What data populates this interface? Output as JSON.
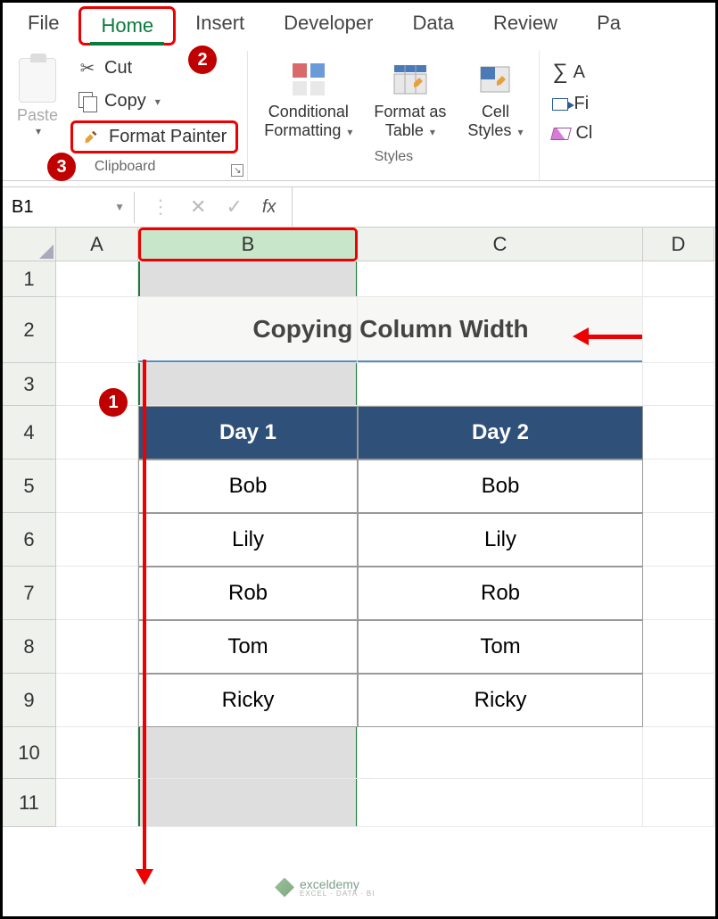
{
  "tabs": {
    "file": "File",
    "home": "Home",
    "insert": "Insert",
    "developer": "Developer",
    "data": "Data",
    "review": "Review",
    "pa": "Pa"
  },
  "clipboard": {
    "paste": "Paste",
    "cut": "Cut",
    "copy": "Copy",
    "format_painter": "Format Painter",
    "group_label": "Clipboard"
  },
  "styles": {
    "conditional": "Conditional",
    "formatting": "Formatting",
    "format_as": "Format as",
    "table": "Table",
    "cell": "Cell",
    "styles2": "Styles",
    "group_label": "Styles"
  },
  "editing": {
    "autosum": "A",
    "fill": "Fi",
    "clear": "Cl"
  },
  "namebox": "B1",
  "fx": "fx",
  "columns": {
    "A": "A",
    "B": "B",
    "C": "C",
    "D": "D"
  },
  "rows": [
    "1",
    "2",
    "3",
    "4",
    "5",
    "6",
    "7",
    "8",
    "9",
    "10",
    "11"
  ],
  "title": "Copying Column Width",
  "headers": {
    "day1": "Day 1",
    "day2": "Day 2"
  },
  "dataB": [
    "Bob",
    "Lily",
    "Rob",
    "Tom",
    "Ricky"
  ],
  "dataC": [
    "Bob",
    "Lily",
    "Rob",
    "Tom",
    "Ricky"
  ],
  "callouts": {
    "c1": "1",
    "c2": "2",
    "c3": "3"
  },
  "watermark": {
    "name": "exceldemy",
    "sub": "EXCEL · DATA · BI"
  }
}
